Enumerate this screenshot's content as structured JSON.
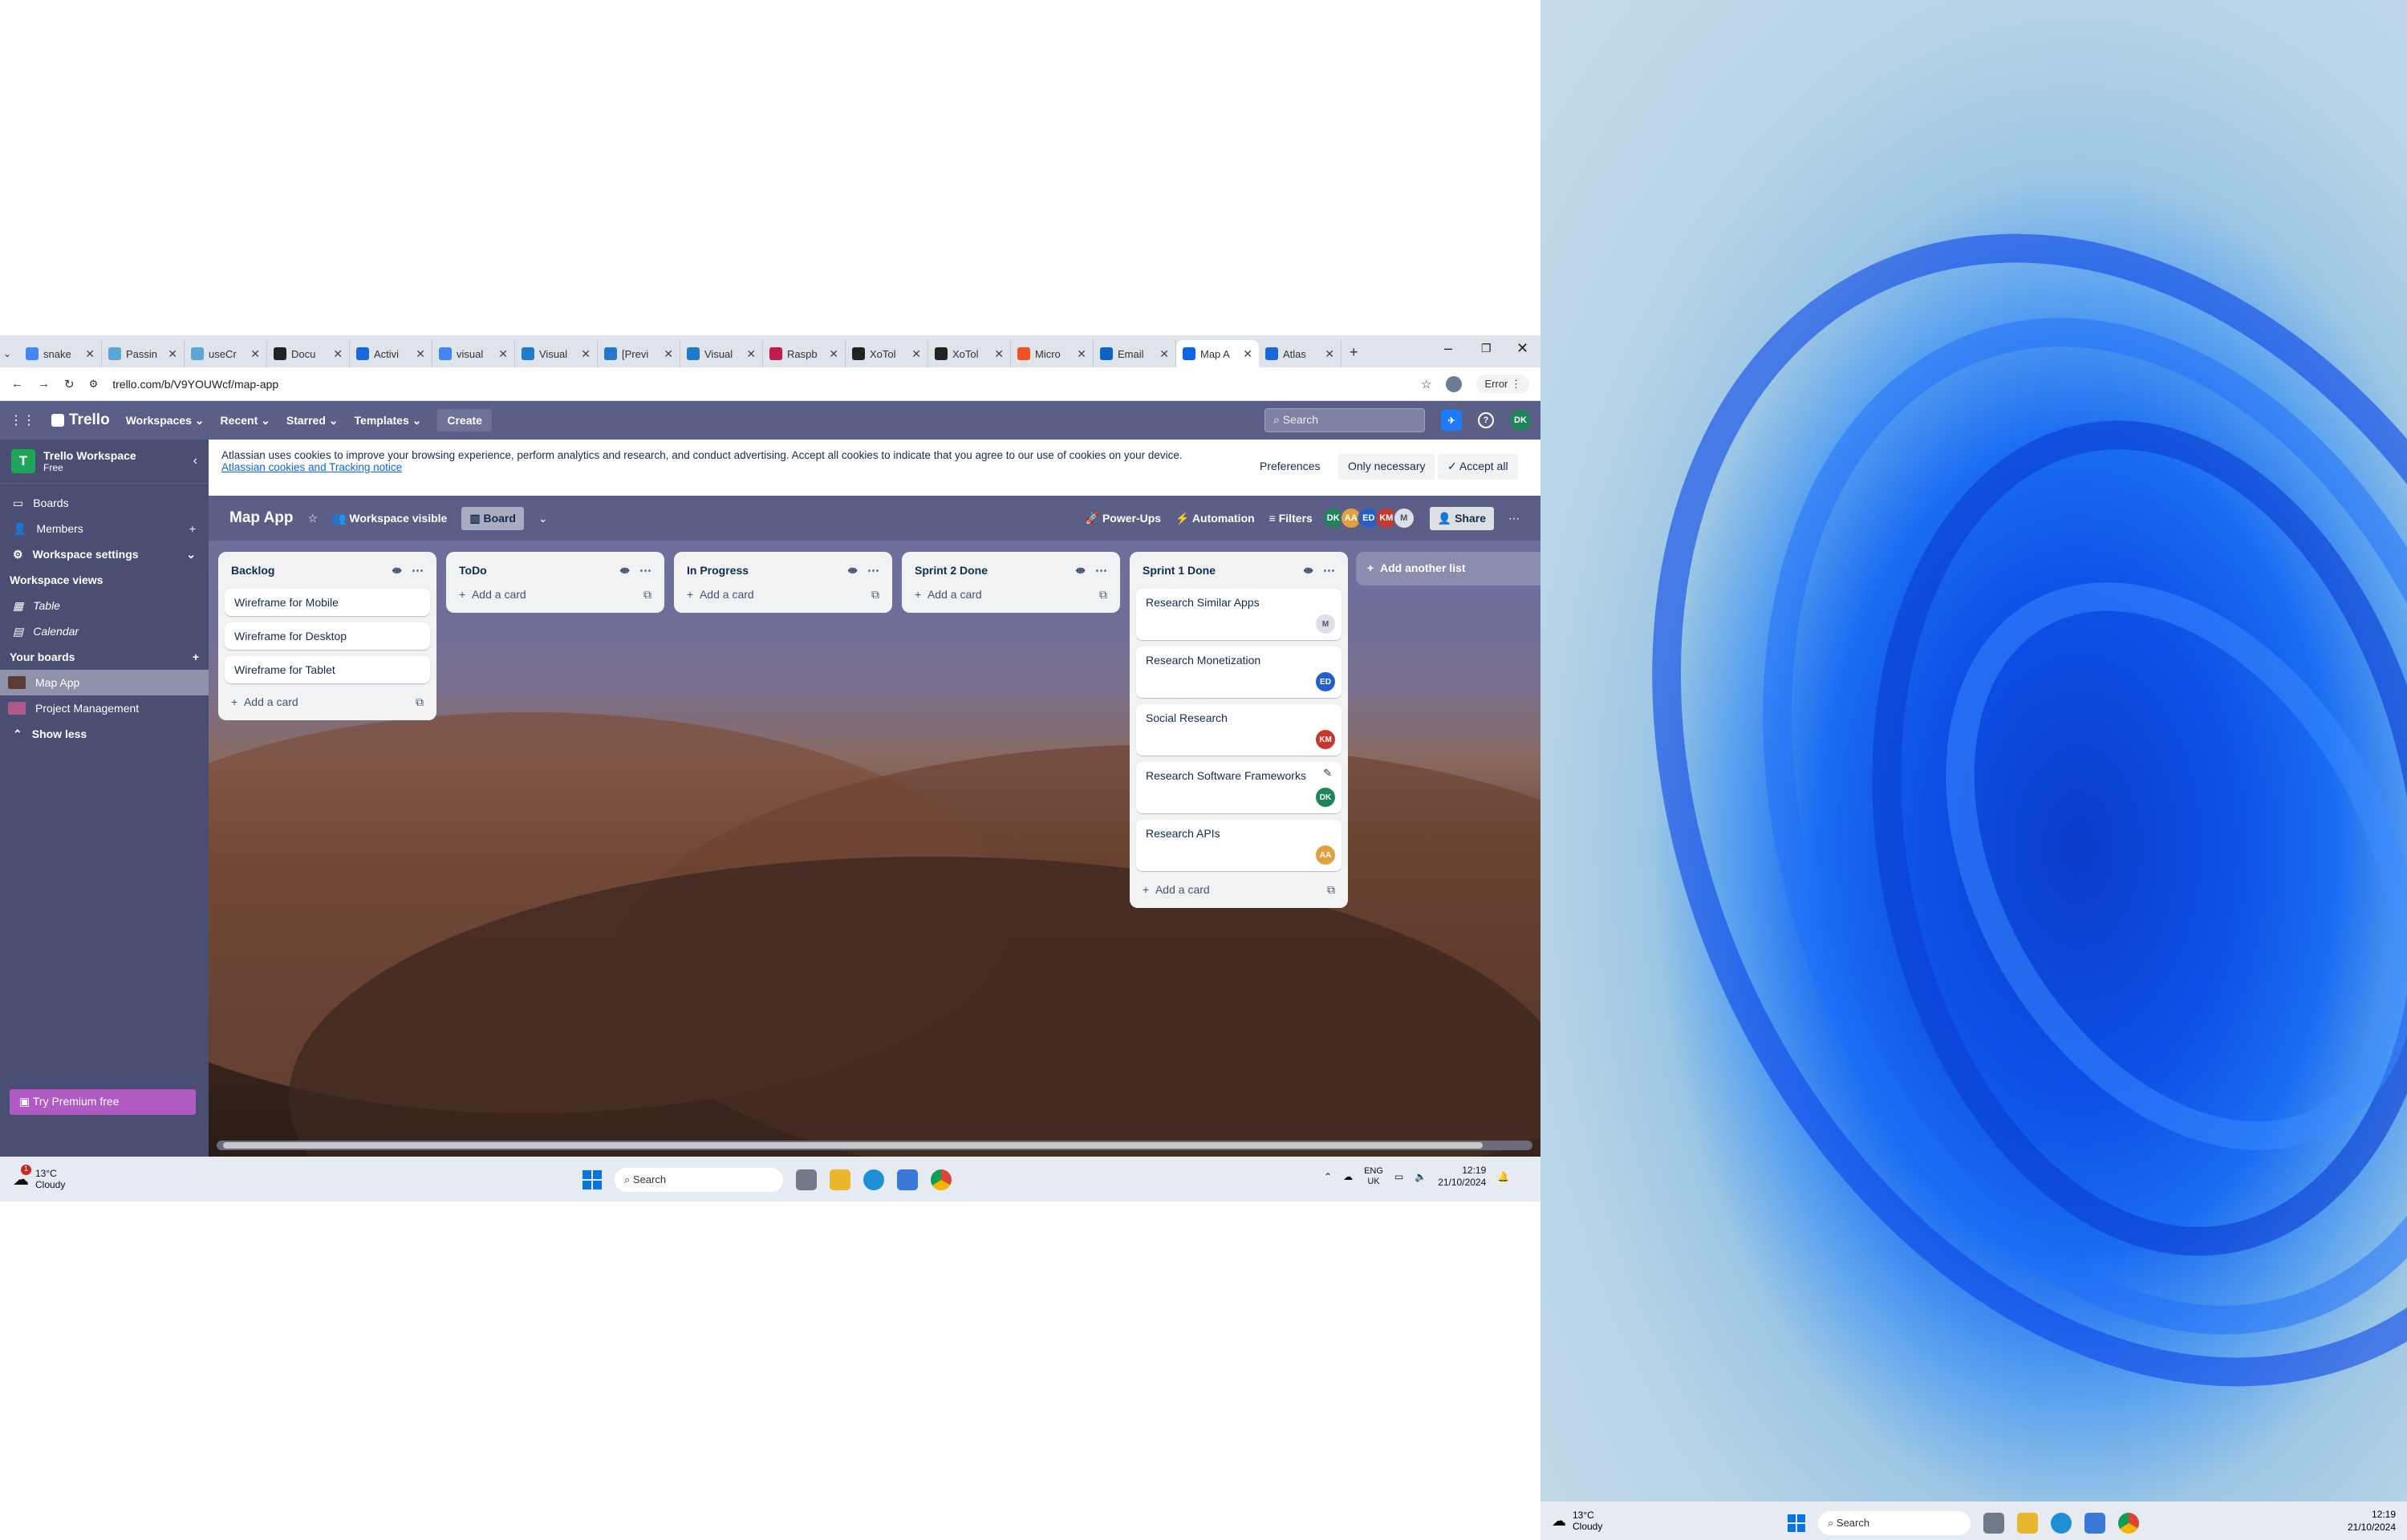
{
  "browser": {
    "tabs": [
      {
        "label": "snake",
        "icon": "google-icon"
      },
      {
        "label": "Passin",
        "icon": "globe-icon"
      },
      {
        "label": "useCr",
        "icon": "globe-icon"
      },
      {
        "label": "Docu",
        "icon": "doc-icon"
      },
      {
        "label": "Activi",
        "icon": "atlassian-icon"
      },
      {
        "label": "visual",
        "icon": "google-icon"
      },
      {
        "label": "Visual",
        "icon": "vscode-icon"
      },
      {
        "label": "[Previ",
        "icon": "vscode-icon"
      },
      {
        "label": "Visual",
        "icon": "vscode-icon"
      },
      {
        "label": "Raspb",
        "icon": "raspberry-icon"
      },
      {
        "label": "XoTol",
        "icon": "github-icon"
      },
      {
        "label": "XoTol",
        "icon": "github-icon"
      },
      {
        "label": "Micro",
        "icon": "microsoft-icon"
      },
      {
        "label": "Email",
        "icon": "outlook-icon"
      },
      {
        "label": "Map A",
        "icon": "trello-icon",
        "active": true
      },
      {
        "label": "Atlas",
        "icon": "atlassian-icon"
      }
    ],
    "url": "trello.com/b/V9YOUWcf/map-app",
    "error_label": "Error"
  },
  "trello_nav": {
    "logo": "Trello",
    "workspaces": "Workspaces",
    "recent": "Recent",
    "starred": "Starred",
    "templates": "Templates",
    "create": "Create",
    "search_placeholder": "Search",
    "user_initials": "DK"
  },
  "sidebar": {
    "workspace_name": "Trello Workspace",
    "workspace_plan": "Free",
    "workspace_initial": "T",
    "items": [
      {
        "label": "Boards"
      },
      {
        "label": "Members"
      },
      {
        "label": "Workspace settings"
      }
    ],
    "views_heading": "Workspace views",
    "views": [
      {
        "label": "Table"
      },
      {
        "label": "Calendar"
      }
    ],
    "your_boards_heading": "Your boards",
    "boards": [
      {
        "label": "Map App",
        "color": "#5b3b33"
      },
      {
        "label": "Project Management",
        "color": "#b0588a"
      }
    ],
    "show_less": "Show less",
    "premium": "Try Premium free"
  },
  "cookie_banner": {
    "text": "Atlassian uses cookies to improve your browsing experience, perform analytics and research, and conduct advertising. Accept all cookies to indicate that you agree to our use of cookies on your device.",
    "link": "Atlassian cookies and Tracking notice",
    "preferences": "Preferences",
    "only_necessary": "Only necessary",
    "accept_all": "Accept all"
  },
  "board_header": {
    "name": "Map App",
    "visibility": "Workspace visible",
    "view": "Board",
    "power_ups": "Power-Ups",
    "automation": "Automation",
    "filters": "Filters",
    "share": "Share",
    "members": [
      {
        "initials": "DK",
        "color": "#1f845a"
      },
      {
        "initials": "AA",
        "color": "#e2a03f"
      },
      {
        "initials": "ED",
        "color": "#2460c8"
      },
      {
        "initials": "KM",
        "color": "#c9372c"
      },
      {
        "initials": "M",
        "color": "#dcdfe4"
      }
    ]
  },
  "lists": [
    {
      "title": "Backlog",
      "cards": [
        {
          "title": "Wireframe for Mobile"
        },
        {
          "title": "Wireframe for Desktop"
        },
        {
          "title": "Wireframe for Tablet"
        }
      ],
      "add": "Add a card"
    },
    {
      "title": "ToDo",
      "cards": [],
      "add": "Add a card"
    },
    {
      "title": "In Progress",
      "cards": [],
      "add": "Add a card"
    },
    {
      "title": "Sprint 2 Done",
      "cards": [],
      "add": "Add a card"
    },
    {
      "title": "Sprint 1 Done",
      "cards": [
        {
          "title": "Research Similar Apps",
          "member": "M",
          "color": "#dcdfe4"
        },
        {
          "title": "Research Monetization",
          "member": "ED",
          "color": "#2460c8"
        },
        {
          "title": "Social Research",
          "member": "KM",
          "color": "#c9372c"
        },
        {
          "title": "Research Software Frameworks",
          "member": "DK",
          "color": "#1f845a"
        },
        {
          "title": "Research APIs",
          "member": "AA",
          "color": "#e2a03f"
        }
      ],
      "add": "Add a card"
    }
  ],
  "add_list": "Add another list",
  "taskbar": {
    "weather_temp": "13°C",
    "weather_desc": "Cloudy",
    "weather_badge": "1",
    "search": "Search",
    "lang": "ENG",
    "region": "UK",
    "time": "12:19",
    "date": "21/10/2024"
  },
  "taskbar2": {
    "weather_temp": "13°C",
    "weather_desc": "Cloudy",
    "search": "Search",
    "time": "12:19",
    "date": "21/10/2024"
  }
}
